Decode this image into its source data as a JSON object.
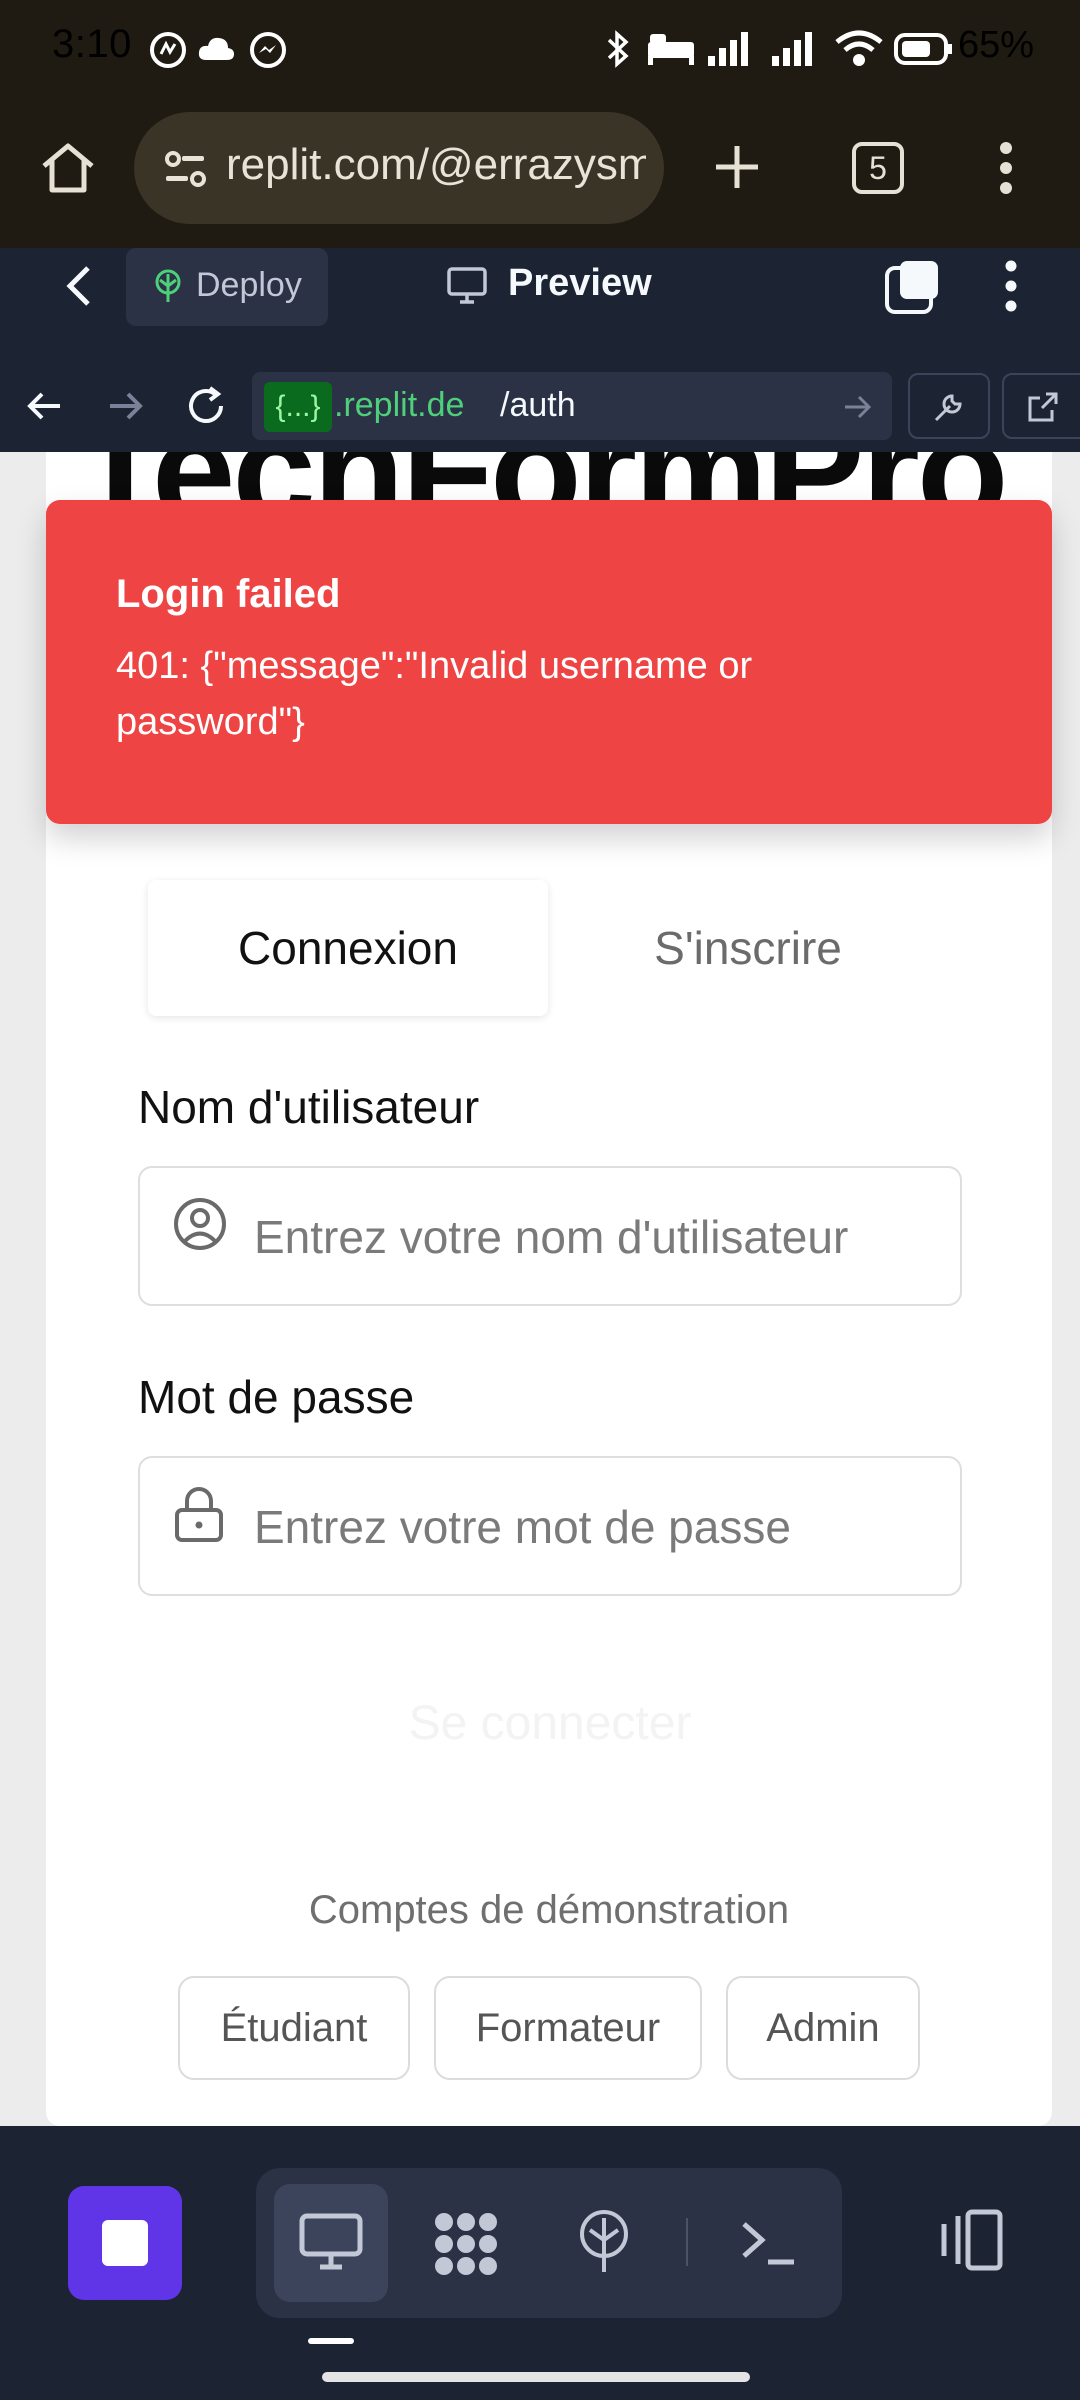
{
  "status_bar": {
    "time": "3:10",
    "battery": "65%",
    "icons": [
      "threads-icon",
      "cloud-icon",
      "messenger-icon",
      "bluetooth-icon",
      "sleep-mode-icon",
      "signal-icon",
      "signal-icon",
      "wifi-icon",
      "battery-icon"
    ]
  },
  "browser": {
    "url": "replit.com/@errazysm",
    "tab_count": "5",
    "icons": [
      "home-icon",
      "site-settings-icon",
      "new-tab-icon",
      "more-vertical-icon"
    ]
  },
  "replit_bar": {
    "deploy_label": "Deploy",
    "preview_label": "Preview"
  },
  "webview": {
    "domain_prefix": "{...}",
    "domain": ".replit.de",
    "path": "/auth"
  },
  "page": {
    "brand": "TechFormPro",
    "toast": {
      "title": "Login failed",
      "message": "401: {\"message\":\"Invalid username or password\"}",
      "color": "#ef4444"
    },
    "tabs": [
      {
        "label": "Connexion",
        "active": true
      },
      {
        "label": "S'inscrire",
        "active": false
      }
    ],
    "username": {
      "label": "Nom d'utilisateur",
      "placeholder": "Entrez votre nom d'utilisateur"
    },
    "password": {
      "label": "Mot de passe",
      "placeholder": "Entrez votre mot de passe"
    },
    "submit_label": "Se connecter",
    "demo": {
      "heading": "Comptes de démonstration",
      "accounts": [
        "Étudiant",
        "Formateur",
        "Admin"
      ]
    }
  },
  "bottom_bar": {
    "accent": "#6035e8",
    "icons": [
      "stop-icon",
      "monitor-icon",
      "apps-icon",
      "deploy-icon",
      "terminal-icon",
      "layout-toggle-icon"
    ]
  }
}
